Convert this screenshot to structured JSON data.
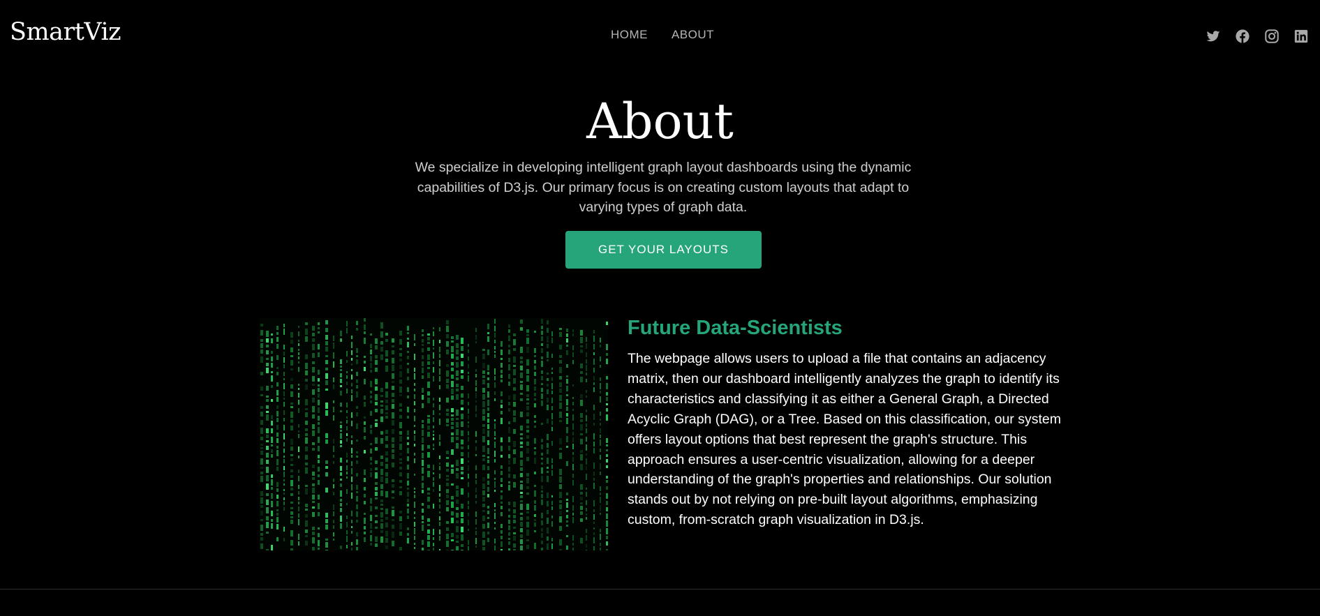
{
  "brand": {
    "logo": "SmartViz"
  },
  "nav": {
    "home": "HOME",
    "about": "ABOUT"
  },
  "social": [
    "twitter-icon",
    "facebook-icon",
    "instagram-icon",
    "linkedin-icon"
  ],
  "hero": {
    "title": "About",
    "description": "We specialize in developing intelligent graph layout dashboards using the dynamic capabilities of D3.js. Our primary focus is on creating custom layouts that adapt to varying types of graph data.",
    "cta_label": "GET YOUR LAYOUTS"
  },
  "feature": {
    "title": "Future Data-Scientists",
    "body": "The webpage allows users to upload a file that contains an adjacency matrix, then our dashboard intelligently analyzes the graph to identify its characteristics and classifying it as either a General Graph, a Directed Acyclic Graph (DAG), or a Tree. Based on this classification, our system offers layout options that best represent the graph's structure. This approach ensures a user-centric visualization, allowing for a deeper understanding of the graph's properties and relationships. Our solution stands out by not relying on pre-built layout algorithms, emphasizing custom, from-scratch graph visualization in D3.js."
  },
  "colors": {
    "accent": "#26a57a",
    "background": "#000000",
    "nav_text": "#b5b5b5",
    "body_text": "#ffffff"
  }
}
